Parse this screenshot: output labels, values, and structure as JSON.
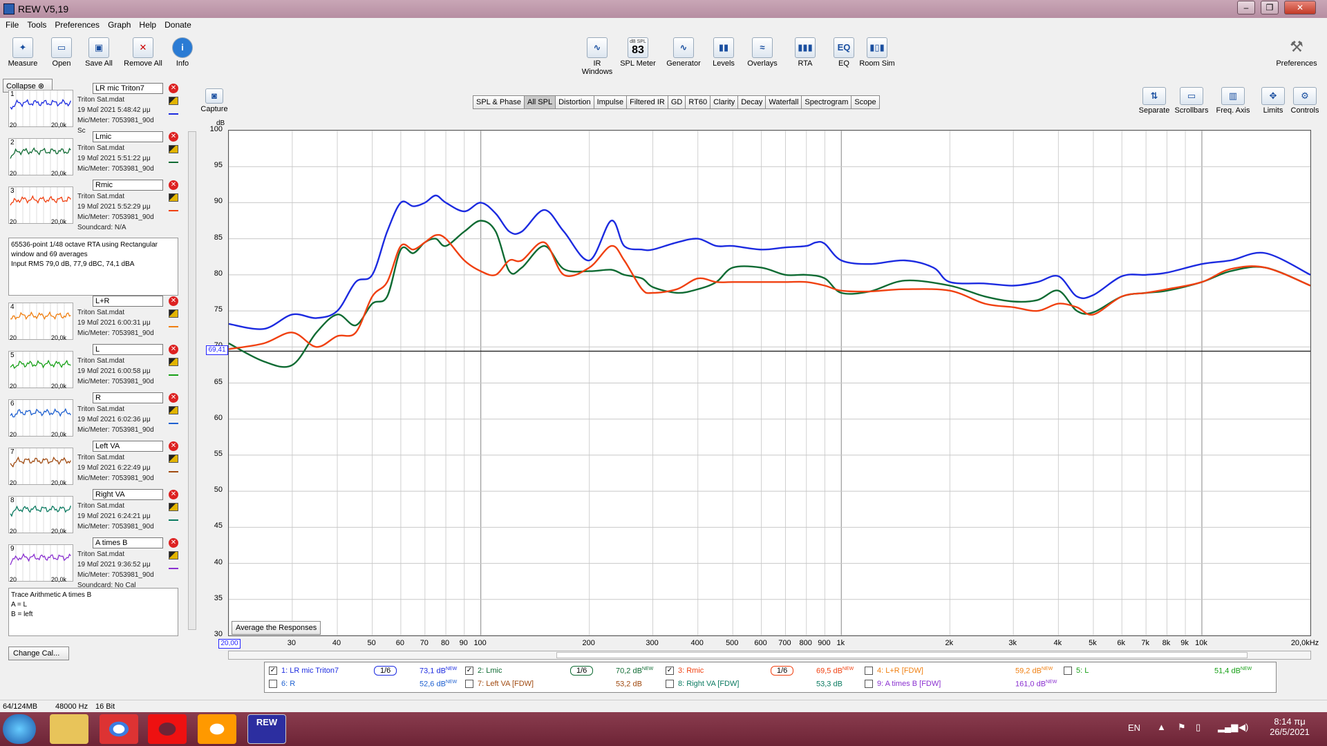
{
  "window": {
    "title": "REW V5,19"
  },
  "menu": [
    "File",
    "Tools",
    "Preferences",
    "Graph",
    "Help",
    "Donate"
  ],
  "toolbar_left": [
    "Measure",
    "Open",
    "Save All",
    "Remove All",
    "Info"
  ],
  "toolbar_center": [
    {
      "label": "IR Windows",
      "glyph": "∿"
    },
    {
      "label": "SPL Meter",
      "glyph": "83",
      "sub": "dB SPL"
    },
    {
      "label": "Generator",
      "glyph": "∿"
    },
    {
      "label": "Levels",
      "glyph": "▮▮"
    },
    {
      "label": "Overlays",
      "glyph": "≈"
    },
    {
      "label": "RTA",
      "glyph": "▮▮▮"
    },
    {
      "label": "EQ",
      "glyph": "EQ"
    },
    {
      "label": "Room Sim",
      "glyph": "▮▯▮"
    }
  ],
  "toolbar_right": "Preferences",
  "panel": {
    "collapse": "Collapse",
    "change_cal": "Change Cal..."
  },
  "measurements": [
    {
      "num": "1",
      "name": "LR mic Triton7",
      "file": "Triton Sat.mdat",
      "date": "19 Μαΐ 2021 5:48:42 μμ",
      "mic": "Mic/Meter: 7053981_90d",
      "sound": "Sc",
      "color": "#1c2be0"
    },
    {
      "num": "2",
      "name": "Lmic",
      "file": "Triton Sat.mdat",
      "date": "19 Μαΐ 2021 5:51:22 μμ",
      "mic": "Mic/Meter: 7053981_90d",
      "sound": "",
      "color": "#0f6b33"
    },
    {
      "num": "3",
      "name": "Rmic",
      "file": "Triton Sat.mdat",
      "date": "19 Μαΐ 2021 5:52:29 μμ",
      "mic": "Mic/Meter: 7053981_90d",
      "sound": "Soundcard: N/A",
      "color": "#f04010"
    },
    {
      "num": "4",
      "name": "L+R",
      "file": "Triton Sat.mdat",
      "date": "19 Μαΐ 2021 6:00:31 μμ",
      "mic": "Mic/Meter: 7053981_90d",
      "sound": "",
      "color": "#f07f10"
    },
    {
      "num": "5",
      "name": "L",
      "file": "Triton Sat.mdat",
      "date": "19 Μαΐ 2021 6:00:58 μμ",
      "mic": "Mic/Meter: 7053981_90d",
      "sound": "",
      "color": "#16a016"
    },
    {
      "num": "6",
      "name": "R",
      "file": "Triton Sat.mdat",
      "date": "19 Μαΐ 2021 6:02:36 μμ",
      "mic": "Mic/Meter: 7053981_90d",
      "sound": "",
      "color": "#1e60d0"
    },
    {
      "num": "7",
      "name": "Left VA",
      "file": "Triton Sat.mdat",
      "date": "19 Μαΐ 2021 6:22:49 μμ",
      "mic": "Mic/Meter: 7053981_90d",
      "sound": "",
      "color": "#a04a10"
    },
    {
      "num": "8",
      "name": "Right VA",
      "file": "Triton Sat.mdat",
      "date": "19 Μαΐ 2021 6:24:21 μμ",
      "mic": "Mic/Meter: 7053981_90d",
      "sound": "",
      "color": "#0a7a60"
    },
    {
      "num": "9",
      "name": "A times B",
      "file": "Triton Sat.mdat",
      "date": "19 Μαΐ 2021 9:36:52 μμ",
      "mic": "Mic/Meter: 7053981_90d",
      "sound": "Soundcard: No Cal",
      "color": "#8a30d0"
    }
  ],
  "info3": [
    "65536-point 1/48 octave RTA using Rectangular",
    "window and 69 averages",
    "Input RMS 79,0 dB, 77,9 dBC, 74,1 dBA"
  ],
  "info9": [
    "Trace Arithmetic A times B",
    "A = L",
    "B = left"
  ],
  "capture": "Capture",
  "graph_tabs": [
    "SPL & Phase",
    "All SPL",
    "Distortion",
    "Impulse",
    "Filtered IR",
    "GD",
    "RT60",
    "Clarity",
    "Decay",
    "Waterfall",
    "Spectrogram",
    "Scope"
  ],
  "active_tab": "All SPL",
  "graph_right_tools": [
    "Separate",
    "Scrollbars",
    "Freq. Axis",
    "Limits",
    "Controls"
  ],
  "avg_button": "Average the Responses",
  "cursor_level": "69,41",
  "x_start": "20,00",
  "chart_data": {
    "type": "line",
    "xscale": "log",
    "xlim": [
      20,
      20000
    ],
    "ylim": [
      30,
      100
    ],
    "ylabel": "dB",
    "yticks": [
      "100",
      "95",
      "90",
      "85",
      "80",
      "75",
      "70",
      "65",
      "60",
      "55",
      "50",
      "45",
      "40",
      "35",
      "30"
    ],
    "xticks": [
      {
        "v": 30,
        "t": "30"
      },
      {
        "v": 40,
        "t": "40"
      },
      {
        "v": 50,
        "t": "50"
      },
      {
        "v": 60,
        "t": "60"
      },
      {
        "v": 70,
        "t": "70"
      },
      {
        "v": 80,
        "t": "80"
      },
      {
        "v": 90,
        "t": "90"
      },
      {
        "v": 100,
        "t": "100"
      },
      {
        "v": 200,
        "t": "200"
      },
      {
        "v": 300,
        "t": "300"
      },
      {
        "v": 400,
        "t": "400"
      },
      {
        "v": 500,
        "t": "500"
      },
      {
        "v": 600,
        "t": "600"
      },
      {
        "v": 700,
        "t": "700"
      },
      {
        "v": 800,
        "t": "800"
      },
      {
        "v": 900,
        "t": "900"
      },
      {
        "v": 1000,
        "t": "1k"
      },
      {
        "v": 2000,
        "t": "2k"
      },
      {
        "v": 3000,
        "t": "3k"
      },
      {
        "v": 4000,
        "t": "4k"
      },
      {
        "v": 5000,
        "t": "5k"
      },
      {
        "v": 6000,
        "t": "6k"
      },
      {
        "v": 7000,
        "t": "7k"
      },
      {
        "v": 8000,
        "t": "8k"
      },
      {
        "v": 9000,
        "t": "9k"
      },
      {
        "v": 10000,
        "t": "10k"
      },
      {
        "v": 20000,
        "t": "20,0kHz"
      }
    ],
    "hline": 69.41,
    "series": [
      {
        "name": "1: LR mic Triton7",
        "color": "#1c2be0",
        "x": [
          20,
          25,
          30,
          35,
          40,
          45,
          50,
          55,
          60,
          65,
          70,
          75,
          80,
          90,
          100,
          110,
          120,
          130,
          150,
          170,
          200,
          230,
          250,
          280,
          300,
          350,
          400,
          450,
          500,
          600,
          700,
          800,
          850,
          900,
          1000,
          1200,
          1500,
          1800,
          2000,
          2500,
          3000,
          3500,
          4000,
          4500,
          5000,
          6000,
          7000,
          8000,
          10000,
          12000,
          15000,
          20000
        ],
        "y": [
          73.2,
          72.5,
          74.5,
          74,
          75,
          79,
          80,
          86,
          90,
          89.5,
          90,
          91,
          90,
          88.8,
          90,
          88.5,
          86,
          86,
          89,
          86,
          82,
          87.5,
          84,
          83.5,
          83.5,
          84.5,
          85,
          84,
          84,
          83.5,
          83.8,
          84,
          84.5,
          84.3,
          82,
          81.5,
          82,
          81,
          79,
          78.8,
          78.5,
          79,
          79.8,
          77,
          77.2,
          79.8,
          80,
          80.3,
          81.5,
          82,
          83,
          80
        ]
      },
      {
        "name": "2: Lmic",
        "color": "#0f6b33",
        "x": [
          20,
          25,
          30,
          35,
          40,
          45,
          50,
          55,
          60,
          65,
          70,
          75,
          80,
          90,
          100,
          110,
          120,
          130,
          150,
          170,
          200,
          230,
          250,
          280,
          300,
          350,
          400,
          450,
          500,
          600,
          700,
          800,
          900,
          1000,
          1200,
          1500,
          2000,
          2500,
          3000,
          3500,
          4000,
          4500,
          5000,
          6000,
          7000,
          8000,
          10000,
          12000,
          15000,
          20000
        ],
        "y": [
          70.5,
          68,
          67.5,
          72,
          74.5,
          73,
          76,
          77,
          83.5,
          83,
          84.5,
          85,
          84,
          86,
          87.5,
          86,
          80.5,
          81,
          84,
          80.8,
          80.5,
          80.7,
          80,
          79.5,
          78.3,
          77.5,
          78,
          79,
          81,
          81,
          80,
          80,
          79.5,
          77.5,
          77.7,
          79.2,
          78.5,
          77,
          76.3,
          76.5,
          77.8,
          75,
          74.8,
          77,
          77.5,
          77.8,
          79,
          80.5,
          81,
          78.5
        ]
      },
      {
        "name": "3: Rmic",
        "color": "#f04010",
        "x": [
          20,
          25,
          30,
          35,
          40,
          45,
          50,
          55,
          60,
          65,
          70,
          75,
          80,
          90,
          100,
          110,
          120,
          130,
          150,
          170,
          200,
          230,
          250,
          280,
          300,
          350,
          400,
          450,
          500,
          600,
          700,
          800,
          900,
          1000,
          1200,
          1500,
          2000,
          2500,
          3000,
          3500,
          4000,
          4500,
          5000,
          6000,
          7000,
          8000,
          10000,
          12000,
          15000,
          20000
        ],
        "y": [
          69.7,
          70.5,
          72,
          70,
          71.5,
          72,
          77,
          79,
          84,
          83.5,
          84.5,
          85.5,
          85,
          82,
          80.5,
          80,
          82,
          82,
          84.5,
          80,
          81,
          84,
          82,
          78,
          77.5,
          78,
          79.5,
          79,
          79,
          79,
          79,
          79,
          78.5,
          77.8,
          77.7,
          78,
          77.8,
          76,
          75.5,
          75,
          76,
          75.5,
          74.5,
          77,
          77.5,
          78,
          79,
          80.8,
          81,
          78.5
        ]
      }
    ]
  },
  "legend": [
    {
      "check": true,
      "label": "1: LR mic Triton7",
      "smooth": "1/6",
      "value": "73,1 dB",
      "new": "NEW",
      "color": "#1c2be0"
    },
    {
      "check": true,
      "label": "2: Lmic",
      "smooth": "1/6",
      "value": "70,2 dB",
      "new": "NEW",
      "color": "#0f6b33"
    },
    {
      "check": true,
      "label": "3: Rmic",
      "smooth": "1/6",
      "value": "69,5 dB",
      "new": "NEW",
      "color": "#f04010"
    },
    {
      "check": false,
      "label": "4: L+R [FDW]",
      "smooth": "",
      "value": "59,2 dB",
      "new": "NEW",
      "color": "#f07f10"
    },
    {
      "check": false,
      "label": "5: L",
      "smooth": "",
      "value": "51,4 dB",
      "new": "NEW",
      "color": "#16a016"
    },
    {
      "check": false,
      "label": "6: R",
      "smooth": "",
      "value": "52,6 dB",
      "new": "NEW",
      "color": "#1e60d0"
    },
    {
      "check": false,
      "label": "7: Left VA [FDW]",
      "smooth": "",
      "value": "53,2 dB",
      "new": "",
      "color": "#a04a10"
    },
    {
      "check": false,
      "label": "8: Right VA [FDW]",
      "smooth": "",
      "value": "53,3 dB",
      "new": "",
      "color": "#0a7a60"
    },
    {
      "check": false,
      "label": "9: A times B [FDW]",
      "smooth": "",
      "value": "161,0 dB",
      "new": "NEW",
      "color": "#8a30d0"
    }
  ],
  "status": {
    "memory": "64/124MB",
    "rate": "48000 Hz",
    "bits": "16 Bit"
  },
  "taskbar": {
    "lang": "EN",
    "time": "8:14 πμ",
    "date": "26/5/2021",
    "rew_label": "REW"
  }
}
